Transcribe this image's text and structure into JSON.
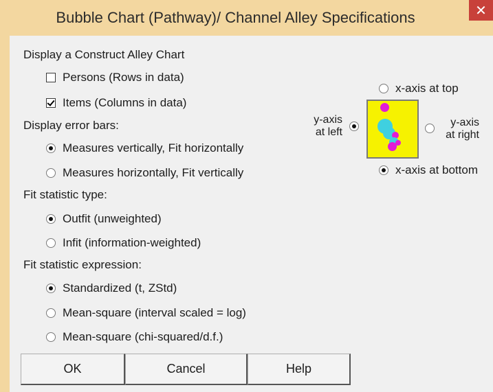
{
  "window": {
    "title": "Bubble Chart (Pathway)/ Channel Alley Specifications",
    "close_glyph": "✕"
  },
  "construct_alley": {
    "heading": "Display a Construct Alley Chart",
    "persons_label": "Persons (Rows in data)",
    "persons_checked": false,
    "items_label": "Items (Columns in data)",
    "items_checked": true
  },
  "error_bars": {
    "heading": "Display error bars:",
    "options": [
      {
        "label": "Measures vertically, Fit horizontally",
        "selected": true
      },
      {
        "label": "Measures horizontally, Fit vertically",
        "selected": false
      }
    ]
  },
  "fit_type": {
    "heading": "Fit statistic type:",
    "options": [
      {
        "label": "Outfit (unweighted)",
        "selected": true
      },
      {
        "label": "Infit (information-weighted)",
        "selected": false
      }
    ]
  },
  "fit_expression": {
    "heading": "Fit statistic expression:",
    "options": [
      {
        "label": "Standardized (t, ZStd)",
        "selected": true
      },
      {
        "label": "Mean-square (interval scaled = log)",
        "selected": false
      },
      {
        "label": "Mean-square (chi-squared/d.f.)",
        "selected": false
      }
    ]
  },
  "axes": {
    "x_top": {
      "label": "x-axis at top",
      "selected": false
    },
    "x_bottom": {
      "label": "x-axis at bottom",
      "selected": true
    },
    "y_left": {
      "line1": "y-axis",
      "line2": "at left",
      "selected": true
    },
    "y_right": {
      "line1": "y-axis",
      "line2": "at right",
      "selected": false
    }
  },
  "preview_colors": {
    "background": "#f6f200",
    "magenta": "#e21bd6",
    "cyan": "#3fd0e0"
  },
  "buttons": {
    "ok": "OK",
    "cancel": "Cancel",
    "help": "Help"
  }
}
